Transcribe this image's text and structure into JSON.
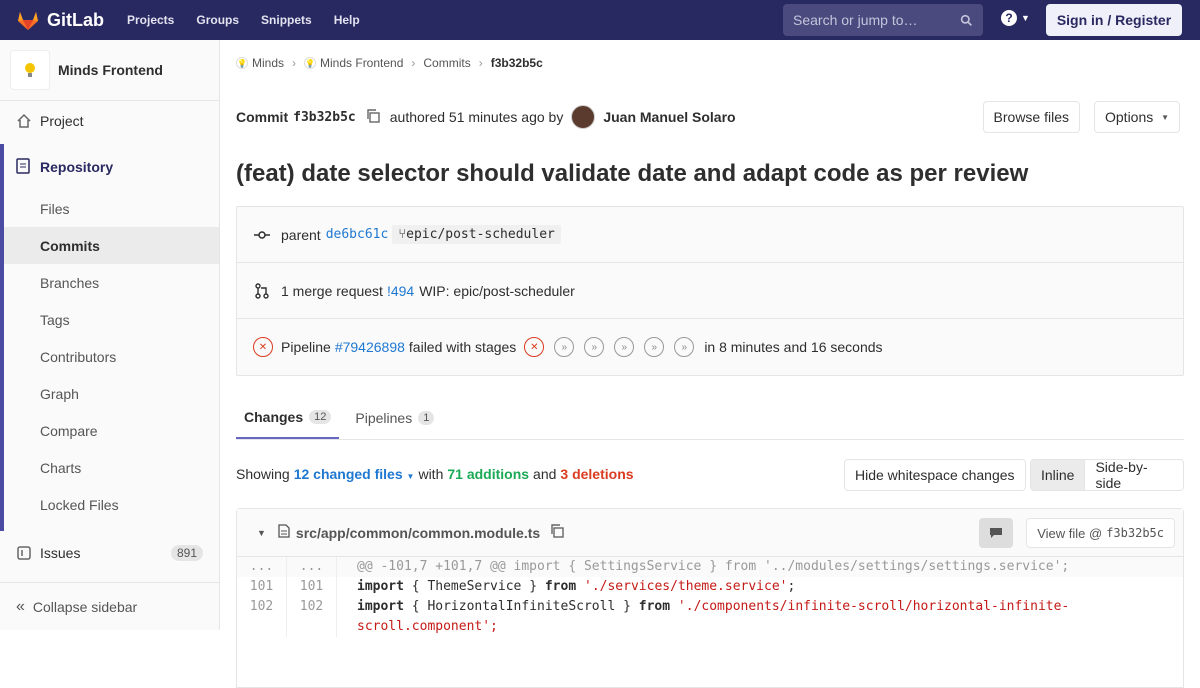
{
  "nav": {
    "brand": "GitLab",
    "links": [
      "Projects",
      "Groups",
      "Snippets",
      "Help"
    ],
    "search_placeholder": "Search or jump to…",
    "signin": "Sign in / Register"
  },
  "sidebar": {
    "project_name": "Minds Frontend",
    "project": "Project",
    "repository": "Repository",
    "repo_items": [
      "Files",
      "Commits",
      "Branches",
      "Tags",
      "Contributors",
      "Graph",
      "Compare",
      "Charts",
      "Locked Files"
    ],
    "issues": "Issues",
    "issues_count": "891",
    "collapse": "Collapse sidebar"
  },
  "breadcrumb": [
    "Minds",
    "Minds Frontend",
    "Commits",
    "f3b32b5c"
  ],
  "commit": {
    "label": "Commit",
    "sha": "f3b32b5c",
    "authored": "authored 51 minutes ago by",
    "author": "Juan Manuel Solaro",
    "browse": "Browse files",
    "options": "Options",
    "title": "(feat) date selector should validate date and adapt code as per review"
  },
  "info": {
    "parent_label": "parent",
    "parent_sha": "de6bc61c",
    "branch": "epic/post-scheduler",
    "mr_text": "1 merge request",
    "mr_link": "!494",
    "mr_title": "WIP: epic/post-scheduler",
    "pipeline_label": "Pipeline",
    "pipeline_link": "#79426898",
    "pipeline_status": "failed with stages",
    "pipeline_time": "in 8 minutes and 16 seconds"
  },
  "tabs": {
    "changes": "Changes",
    "changes_count": "12",
    "pipelines": "Pipelines",
    "pipelines_count": "1"
  },
  "summary": {
    "showing": "Showing",
    "files": "12 changed files",
    "with": "with",
    "additions": "71 additions",
    "and": "and",
    "deletions": "3 deletions",
    "hide_ws": "Hide whitespace changes",
    "inline": "Inline",
    "side": "Side-by-side"
  },
  "file": {
    "path": "src/app/common/common.module.ts",
    "view_file": "View file @",
    "view_sha": "f3b32b5c",
    "hunk": "@@ -101,7 +101,7 @@ import { SettingsService } from '../modules/settings/settings.service';",
    "lines": [
      {
        "old": "101",
        "new": "101",
        "kw": "import",
        "mid": " { ThemeService } ",
        "from": "from",
        "str": "'./services/theme.service'",
        "end": ";"
      },
      {
        "old": "102",
        "new": "102",
        "kw": "import",
        "mid": " { HorizontalInfiniteScroll } ",
        "from": "from",
        "str": "'./components/infinite-scroll/horizontal-infinite-",
        "end": ""
      }
    ],
    "wrap": "scroll.component';"
  }
}
